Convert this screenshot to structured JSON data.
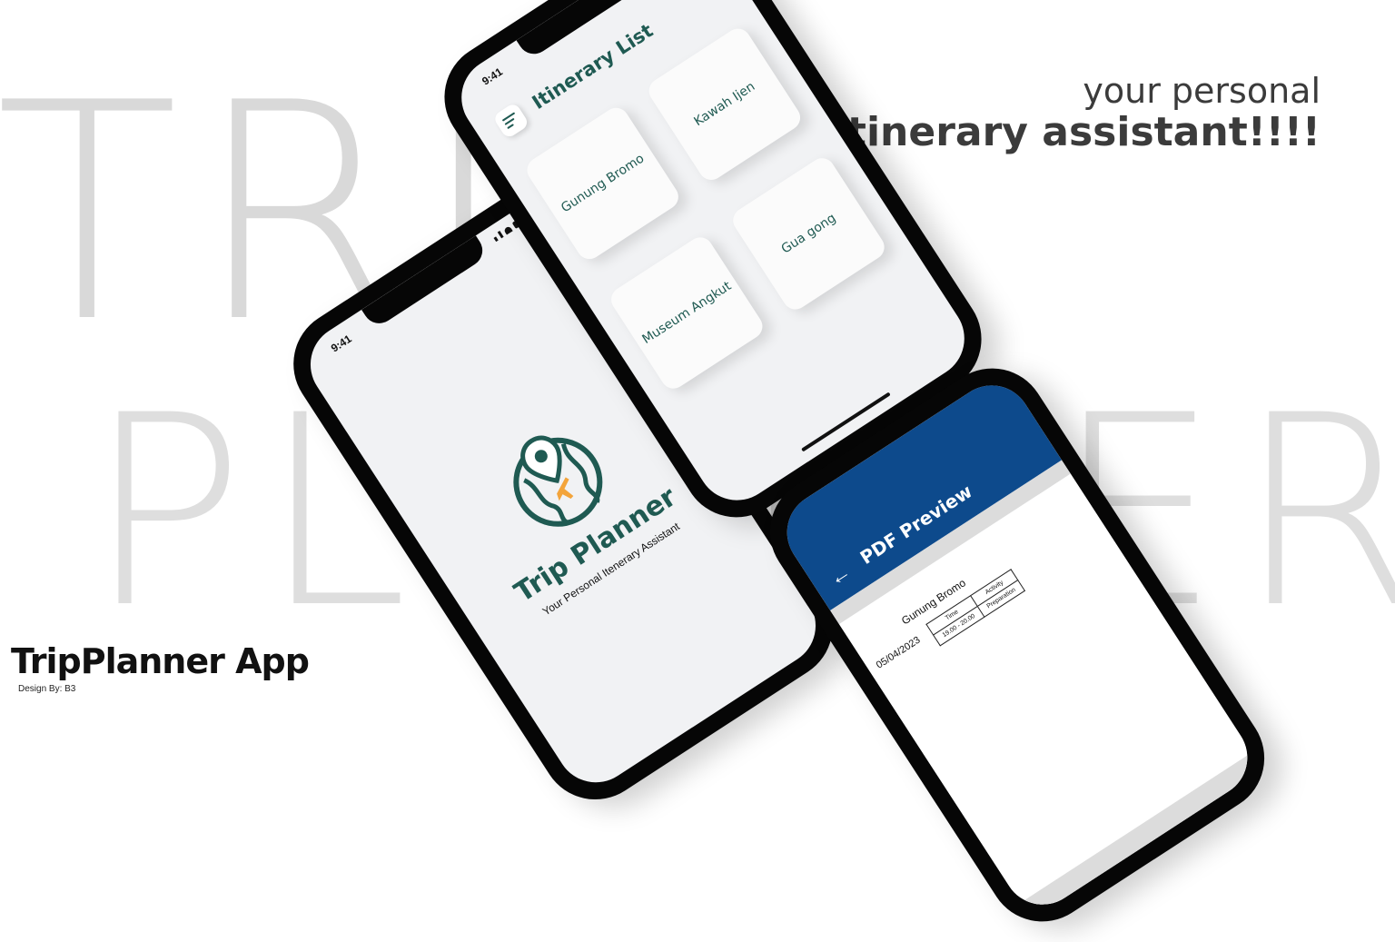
{
  "background": {
    "word_top": "TRIP",
    "word_bottom": "PLANNER"
  },
  "tagline": {
    "line1": "your personal",
    "line2": "itinerary assistant!!!!"
  },
  "brand": {
    "title": "TripPlanner App",
    "credit": "Design By: B3"
  },
  "colors": {
    "primary_green": "#1f5a52",
    "pdf_header_blue": "#0d4a8c",
    "accent_orange": "#f3a43b",
    "screen_bg": "#f1f2f4"
  },
  "list_screen": {
    "time": "9:41",
    "title": "Itinerary List",
    "menu_icon": "hamburger-menu-icon",
    "cards": [
      {
        "label": "Gunung Bromo"
      },
      {
        "label": "Kawah Ijen"
      },
      {
        "label": "Museum Angkut"
      },
      {
        "label": "Gua gong"
      }
    ]
  },
  "splash_screen": {
    "time": "9:41",
    "logo_icon": "globe-location-pin-airplane-icon",
    "app_name": "Trip Planner",
    "subtitle": "Your Personal Itenerary Assistant"
  },
  "pdf_screen": {
    "back_icon": "arrow-left-icon",
    "title": "PDF Preview",
    "doc_title": "Gunung Bromo",
    "date": "05/04/2023",
    "table": {
      "headers": [
        "Time",
        "Activity"
      ],
      "rows": [
        [
          "19.00 - 20.00",
          "Preparation"
        ]
      ]
    }
  }
}
